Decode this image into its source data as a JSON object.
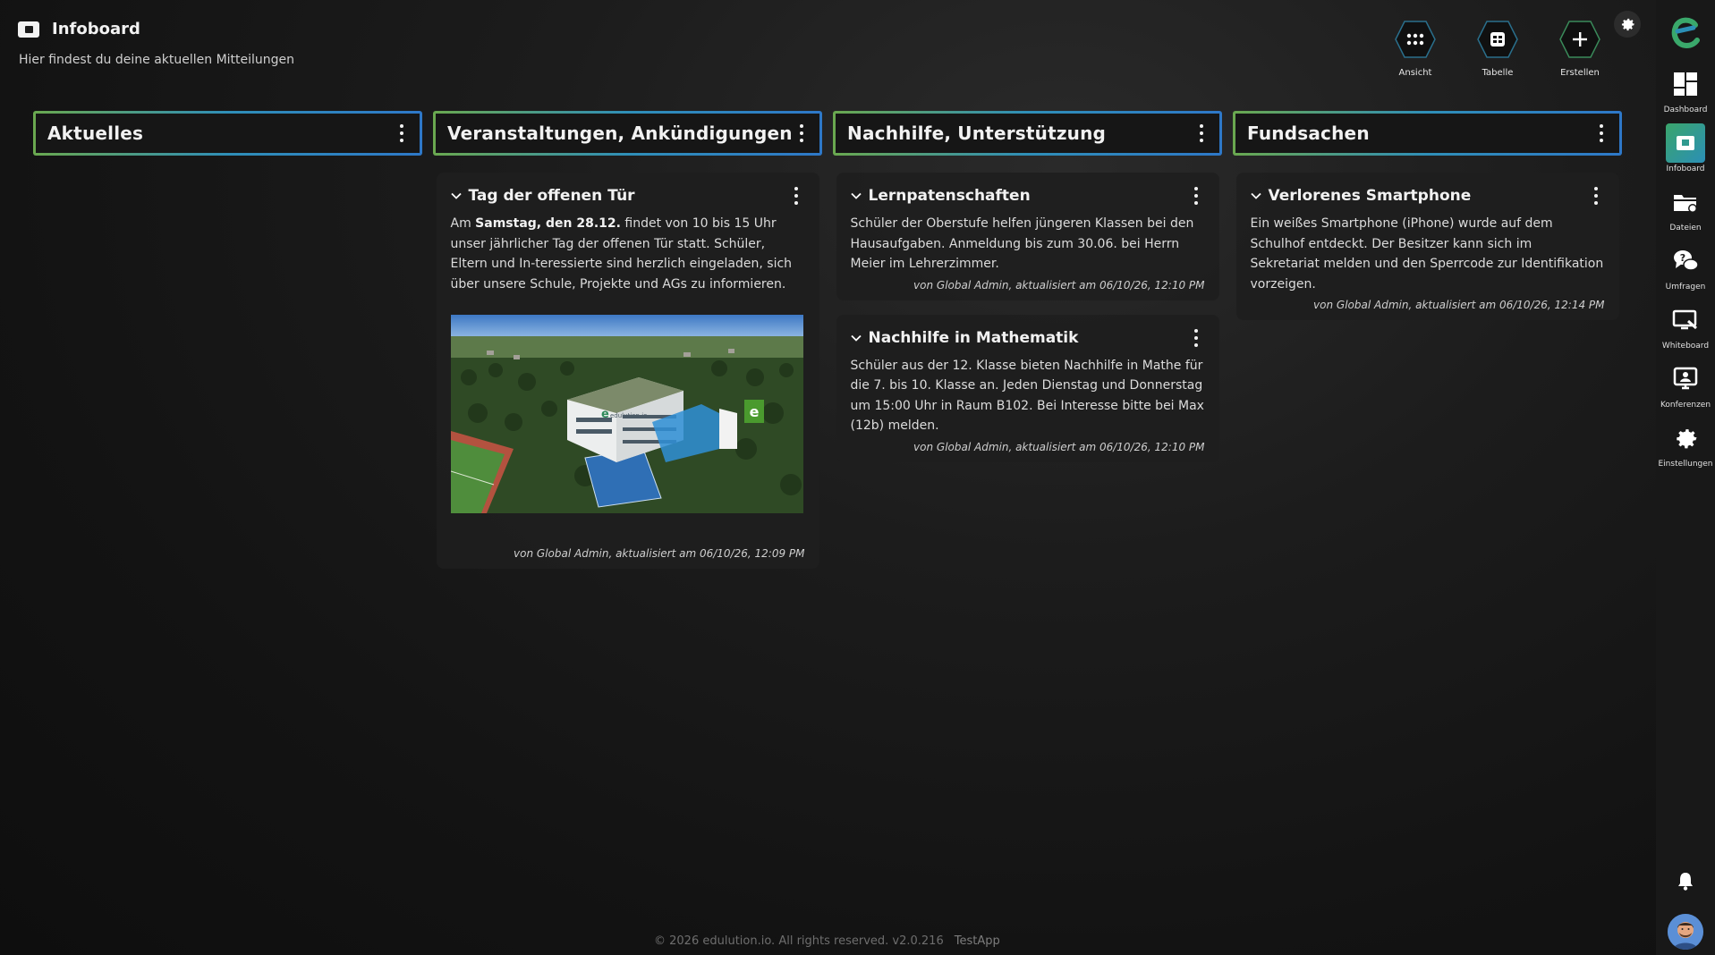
{
  "header": {
    "title": "Infoboard",
    "subtitle": "Hier findest du deine aktuellen Mitteilungen",
    "icon": "infoboard-icon"
  },
  "actions": [
    {
      "label": "Ansicht",
      "icon": "grid-dots-icon"
    },
    {
      "label": "Tabelle",
      "icon": "table-icon"
    },
    {
      "label": "Erstellen",
      "icon": "plus-icon"
    }
  ],
  "settings_icon": "gear-icon",
  "columns": [
    {
      "title": "Aktuelles",
      "cards": []
    },
    {
      "title": "Veranstaltungen, Ankündigungen",
      "cards": [
        {
          "title": "Tag der offenen Tür",
          "body_parts": [
            "Am ",
            "Samstag, den 28.12.",
            " findet von 10 bis 15 Uhr unser jährlicher Tag der offenen Tür statt. Schüler, Eltern und In-teressierte sind herzlich eingeladen, sich über unsere Schule, Projekte und AGs zu informieren."
          ],
          "image": "school-building-aerial-image",
          "image_sign": "edulution.io",
          "meta": "von Global Admin, aktualisiert am 06/10/26, 12:09 PM"
        }
      ]
    },
    {
      "title": "Nachhilfe, Unterstützung",
      "cards": [
        {
          "title": "Lernpatenschaften",
          "body": "Schüler der Oberstufe helfen jüngeren Klassen bei den Hausaufgaben. Anmeldung bis zum 30.06. bei Herrn Meier im Lehrerzimmer.",
          "meta": "von Global Admin, aktualisiert am 06/10/26, 12:10 PM"
        },
        {
          "title": "Nachhilfe in Mathematik",
          "body": "Schüler aus der 12. Klasse bieten Nachhilfe in Mathe für die 7. bis 10. Klasse an. Jeden Dienstag und Donnerstag um 15:00 Uhr in Raum B102. Bei Interesse bitte bei Max (12b) melden.",
          "meta": "von Global Admin, aktualisiert am 06/10/26, 12:10 PM"
        }
      ]
    },
    {
      "title": "Fundsachen",
      "cards": [
        {
          "title": "Verlorenes Smartphone",
          "body": "Ein weißes Smartphone (iPhone) wurde auf dem Schulhof entdeckt. Der Besitzer kann sich im Sekretariat melden und den Sperrcode zur Identifikation vorzeigen.",
          "meta": "von Global Admin, aktualisiert am 06/10/26, 12:14 PM"
        }
      ]
    }
  ],
  "sidebar": {
    "logo": "edulution-logo-icon",
    "items": [
      {
        "label": "Dashboard",
        "icon": "dashboard-icon",
        "active": false
      },
      {
        "label": "Infoboard",
        "icon": "infoboard-icon",
        "active": true
      },
      {
        "label": "Dateien",
        "icon": "folder-icon",
        "active": false
      },
      {
        "label": "Umfragen",
        "icon": "survey-chat-icon",
        "active": false
      },
      {
        "label": "Whiteboard",
        "icon": "whiteboard-icon",
        "active": false
      },
      {
        "label": "Konferenzen",
        "icon": "conference-icon",
        "active": false
      },
      {
        "label": "Einstellungen",
        "icon": "gear-icon",
        "active": false
      }
    ],
    "bell_icon": "bell-icon",
    "avatar": "user-avatar"
  },
  "footer": {
    "copyright": "© 2026 edulution.io. All rights reserved. v2.0.216",
    "app": "TestApp"
  },
  "colors": {
    "column_border_start": "#6aa84f",
    "column_border_end": "#2e78c8",
    "active_nav_start": "#3aa56b",
    "active_nav_end": "#2b8fb6",
    "logo": "#3aa86b"
  }
}
